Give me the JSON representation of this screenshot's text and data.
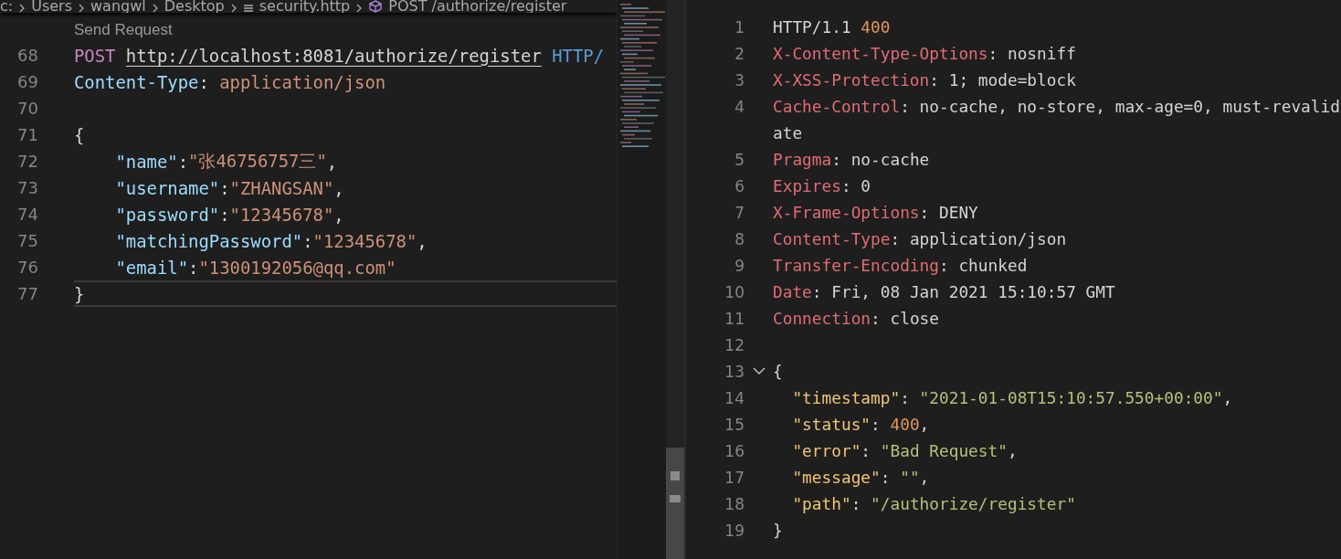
{
  "breadcrumb": {
    "items": [
      {
        "kind": "folder",
        "label": "c:"
      },
      {
        "kind": "folder",
        "label": "Users"
      },
      {
        "kind": "folder",
        "label": "wangwl"
      },
      {
        "kind": "folder",
        "label": "Desktop"
      },
      {
        "kind": "file",
        "label": "security.http"
      },
      {
        "kind": "request",
        "label": "POST /authorize/register"
      }
    ]
  },
  "request_editor": {
    "code_lens": "Send Request",
    "lines": [
      {
        "number": "68",
        "current": false,
        "tokens": [
          {
            "kind": "method",
            "text": "POST"
          },
          {
            "kind": "url",
            "text": "http://localhost:8081/authorize/register"
          },
          {
            "kind": "version",
            "text": "HTTP/"
          }
        ]
      },
      {
        "number": "69",
        "current": false,
        "tokens": [
          {
            "kind": "header-name",
            "text": "Content-Type"
          },
          {
            "kind": "plain",
            "text": ": "
          },
          {
            "kind": "header-value",
            "text": "application/json"
          }
        ]
      },
      {
        "number": "70",
        "current": false
      },
      {
        "number": "71",
        "current": false,
        "tokens": [
          {
            "kind": "brace",
            "text": "{"
          }
        ],
        "children": [
          {
            "number": "72",
            "current": false,
            "tokens": [
              {
                "kind": "key",
                "text": "\"name\""
              },
              {
                "kind": "plain",
                "text": ":"
              },
              {
                "kind": "string",
                "text": "\"张46756757三\""
              },
              {
                "kind": "plain",
                "text": ","
              }
            ]
          },
          {
            "number": "73",
            "current": false,
            "tokens": [
              {
                "kind": "key",
                "text": "\"username\""
              },
              {
                "kind": "plain",
                "text": ":"
              },
              {
                "kind": "string",
                "text": "\"ZHANGSAN\""
              },
              {
                "kind": "plain",
                "text": ","
              }
            ]
          },
          {
            "number": "74",
            "current": false,
            "tokens": [
              {
                "kind": "key",
                "text": "\"password\""
              },
              {
                "kind": "plain",
                "text": ":"
              },
              {
                "kind": "string",
                "text": "\"12345678\""
              },
              {
                "kind": "plain",
                "text": ","
              }
            ]
          },
          {
            "number": "75",
            "current": false,
            "tokens": [
              {
                "kind": "key",
                "text": "\"matchingPassword\""
              },
              {
                "kind": "plain",
                "text": ":"
              },
              {
                "kind": "string",
                "text": "\"12345678\""
              },
              {
                "kind": "plain",
                "text": ","
              }
            ]
          },
          {
            "number": "76",
            "current": false,
            "tokens": [
              {
                "kind": "key",
                "text": "\"email\""
              },
              {
                "kind": "plain",
                "text": ":"
              },
              {
                "kind": "string",
                "text": "\"1300192056@qq.com\""
              }
            ]
          }
        ]
      },
      {
        "number": "77",
        "current": true,
        "tokens": [
          {
            "kind": "brace",
            "text": "}"
          }
        ]
      }
    ]
  },
  "response_editor": {
    "lines": [
      {
        "number": "1",
        "tokens": [
          {
            "kind": "plain",
            "text": "HTTP/1.1"
          },
          {
            "kind": "number",
            "text": "400"
          }
        ]
      },
      {
        "number": "2",
        "tokens": [
          {
            "kind": "header-name",
            "text": "X-Content-Type-Options"
          },
          {
            "kind": "plain",
            "text": ": nosniff"
          }
        ]
      },
      {
        "number": "3",
        "tokens": [
          {
            "kind": "header-name",
            "text": "X-XSS-Protection"
          },
          {
            "kind": "plain",
            "text": ": 1; mode=block"
          }
        ]
      },
      {
        "number": "4",
        "tokens": [
          {
            "kind": "header-name",
            "text": "Cache-Control"
          },
          {
            "kind": "plain",
            "text": ": no-cache, no-store, max-age=0, must-revalid"
          }
        ]
      },
      {
        "tokens": [
          {
            "kind": "plain",
            "text": "ate"
          }
        ]
      },
      {
        "number": "5",
        "tokens": [
          {
            "kind": "header-name",
            "text": "Pragma"
          },
          {
            "kind": "plain",
            "text": ": no-cache"
          }
        ]
      },
      {
        "number": "6",
        "tokens": [
          {
            "kind": "header-name",
            "text": "Expires"
          },
          {
            "kind": "plain",
            "text": ": 0"
          }
        ]
      },
      {
        "number": "7",
        "tokens": [
          {
            "kind": "header-name",
            "text": "X-Frame-Options"
          },
          {
            "kind": "plain",
            "text": ": DENY"
          }
        ]
      },
      {
        "number": "8",
        "tokens": [
          {
            "kind": "header-name",
            "text": "Content-Type"
          },
          {
            "kind": "plain",
            "text": ": application/json"
          }
        ]
      },
      {
        "number": "9",
        "tokens": [
          {
            "kind": "header-name",
            "text": "Transfer-Encoding"
          },
          {
            "kind": "plain",
            "text": ": chunked"
          }
        ]
      },
      {
        "number": "10",
        "tokens": [
          {
            "kind": "header-name",
            "text": "Date"
          },
          {
            "kind": "plain",
            "text": ": Fri, 08 Jan 2021 15:10:57 GMT"
          }
        ]
      },
      {
        "number": "11",
        "tokens": [
          {
            "kind": "header-name",
            "text": "Connection"
          },
          {
            "kind": "plain",
            "text": ": close"
          }
        ]
      },
      {
        "number": "12"
      },
      {
        "number": "13",
        "expanded": true,
        "tokens": [
          {
            "kind": "plain",
            "text": "{"
          }
        ],
        "children": [
          {
            "number": "14",
            "tokens": [
              {
                "kind": "key",
                "text": "\"timestamp\""
              },
              {
                "kind": "plain",
                "text": ":"
              },
              {
                "kind": "string",
                "text": "\"2021-01-08T15:10:57.550+00:00\""
              },
              {
                "kind": "plain",
                "text": ","
              }
            ]
          },
          {
            "number": "15",
            "tokens": [
              {
                "kind": "key",
                "text": "\"status\""
              },
              {
                "kind": "plain",
                "text": ":"
              },
              {
                "kind": "number",
                "text": "400"
              },
              {
                "kind": "plain",
                "text": ","
              }
            ]
          },
          {
            "number": "16",
            "tokens": [
              {
                "kind": "key",
                "text": "\"error\""
              },
              {
                "kind": "plain",
                "text": ":"
              },
              {
                "kind": "string",
                "text": "\"Bad Request\""
              },
              {
                "kind": "plain",
                "text": ","
              }
            ]
          },
          {
            "number": "17",
            "tokens": [
              {
                "kind": "key",
                "text": "\"message\""
              },
              {
                "kind": "plain",
                "text": ":"
              },
              {
                "kind": "string",
                "text": "\"\""
              },
              {
                "kind": "plain",
                "text": ","
              }
            ]
          },
          {
            "number": "18",
            "tokens": [
              {
                "kind": "key",
                "text": "\"path\""
              },
              {
                "kind": "plain",
                "text": ":"
              },
              {
                "kind": "string",
                "text": "\"/authorize/register\""
              }
            ]
          }
        ]
      },
      {
        "number": "19",
        "tokens": [
          {
            "kind": "plain",
            "text": "}"
          }
        ]
      }
    ]
  }
}
